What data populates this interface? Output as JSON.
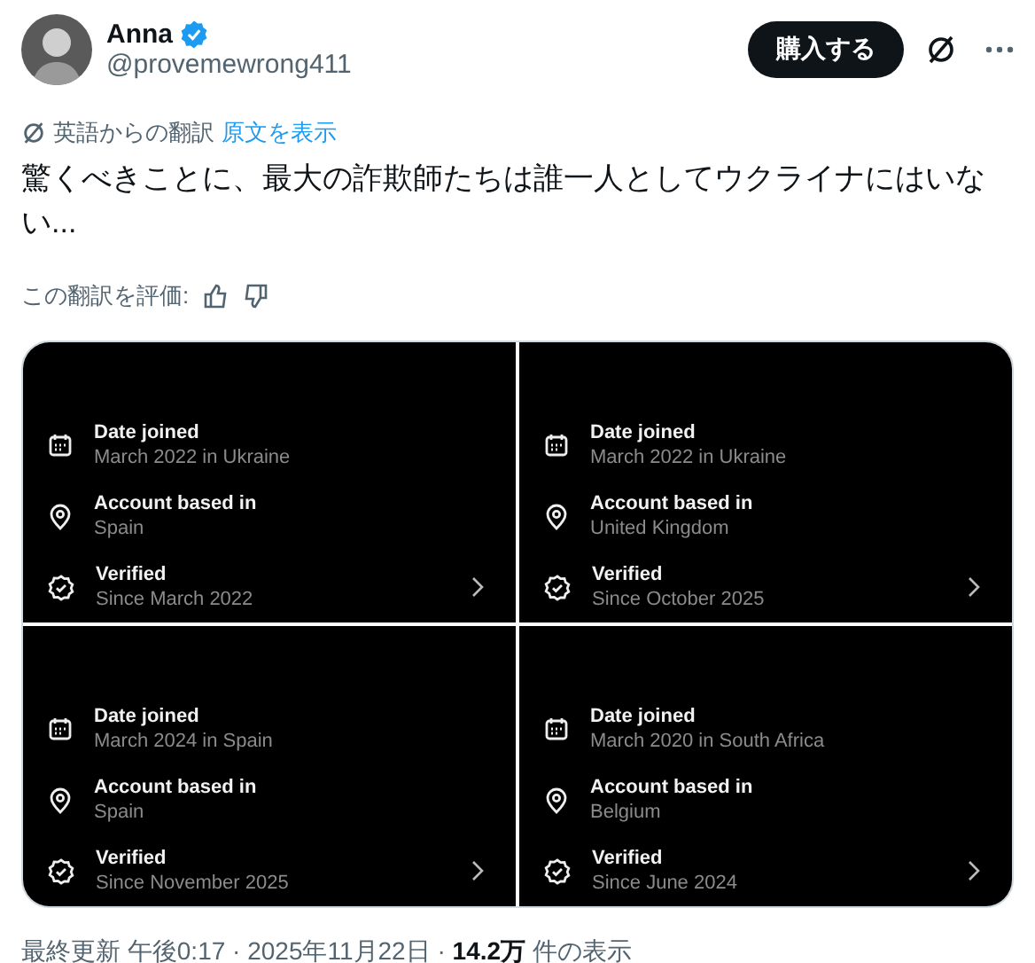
{
  "author": {
    "name": "Anna",
    "verified": true,
    "handle": "@provemewrong411"
  },
  "buy_button": "購入する",
  "translation": {
    "label": "英語からの翻訳",
    "link": "原文を表示"
  },
  "text": "驚くべきことに、最大の詐欺師たちは誰一人としてウクライナにはいない...",
  "rate": {
    "label": "この翻訳を評価:"
  },
  "images": [
    {
      "rows": [
        {
          "kind": "date",
          "label": "Date joined",
          "value": "March 2022 in Ukraine"
        },
        {
          "kind": "location",
          "label": "Account based in",
          "value": "Spain"
        },
        {
          "kind": "verified",
          "label": "Verified",
          "value": "Since March 2022"
        }
      ]
    },
    {
      "rows": [
        {
          "kind": "date",
          "label": "Date joined",
          "value": "March 2022 in Ukraine"
        },
        {
          "kind": "location",
          "label": "Account based in",
          "value": "United Kingdom"
        },
        {
          "kind": "verified",
          "label": "Verified",
          "value": "Since October 2025"
        }
      ]
    },
    {
      "rows": [
        {
          "kind": "date",
          "label": "Date joined",
          "value": "March 2024 in Spain"
        },
        {
          "kind": "location",
          "label": "Account based in",
          "value": "Spain"
        },
        {
          "kind": "verified",
          "label": "Verified",
          "value": "Since November 2025"
        }
      ]
    },
    {
      "rows": [
        {
          "kind": "date",
          "label": "Date joined",
          "value": "March 2020 in South Africa"
        },
        {
          "kind": "location",
          "label": "Account based in",
          "value": "Belgium"
        },
        {
          "kind": "verified",
          "label": "Verified",
          "value": "Since June 2024"
        }
      ]
    }
  ],
  "footer": {
    "text": "最終更新 午後0:17 · 2025年11月22日 · **14.2万** 件の表示"
  }
}
